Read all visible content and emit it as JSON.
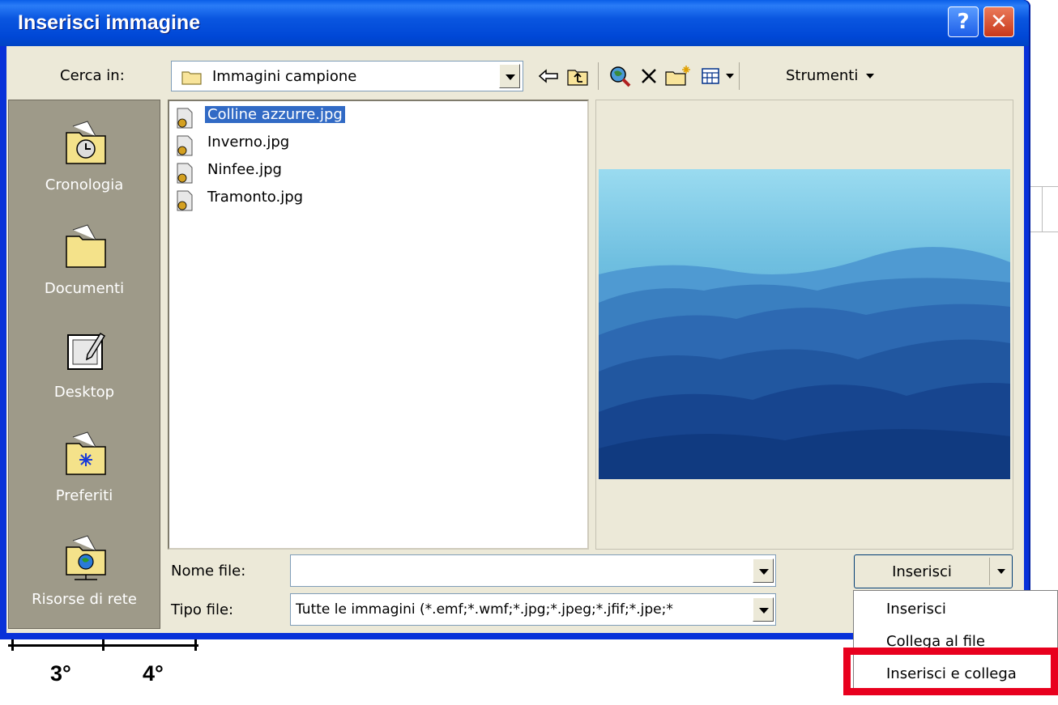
{
  "background": {
    "ruler_numbers": [
      "3°",
      "4°"
    ]
  },
  "dialog": {
    "title": "Inserisci immagine",
    "help_button": "?",
    "close_button": "✕",
    "toolbar": {
      "look_in_label": "Cerca in:",
      "look_in_value": "Immagini campione",
      "back_icon": "back-arrow-icon",
      "up_icon": "up-one-level-icon",
      "search_icon": "search-web-icon",
      "delete_icon": "delete-icon",
      "new_folder_icon": "new-folder-icon",
      "views_icon": "views-icon",
      "tools_label": "Strumenti"
    },
    "places": [
      {
        "label": "Cronologia",
        "icon": "history-folder-icon"
      },
      {
        "label": "Documenti",
        "icon": "documents-folder-icon"
      },
      {
        "label": "Desktop",
        "icon": "desktop-icon"
      },
      {
        "label": "Preferiti",
        "icon": "favorites-folder-icon"
      },
      {
        "label": "Risorse di rete",
        "icon": "network-folder-icon"
      }
    ],
    "files": [
      {
        "name": "Colline azzurre.jpg",
        "selected": true
      },
      {
        "name": "Inverno.jpg",
        "selected": false
      },
      {
        "name": "Ninfee.jpg",
        "selected": false
      },
      {
        "name": "Tramonto.jpg",
        "selected": false
      }
    ],
    "file_name_label": "Nome file:",
    "file_name_value": "",
    "file_type_label": "Tipo file:",
    "file_type_value": "Tutte le immagini (*.emf;*.wmf;*.jpg;*.jpeg;*.jfif;*.jpe;*",
    "insert_button": "Inserisci"
  },
  "insert_menu": {
    "items": [
      "Inserisci",
      "Collega al file",
      "Inserisci e collega"
    ],
    "highlighted": "Inserisci e collega",
    "highlight_color": "#e8001e"
  }
}
